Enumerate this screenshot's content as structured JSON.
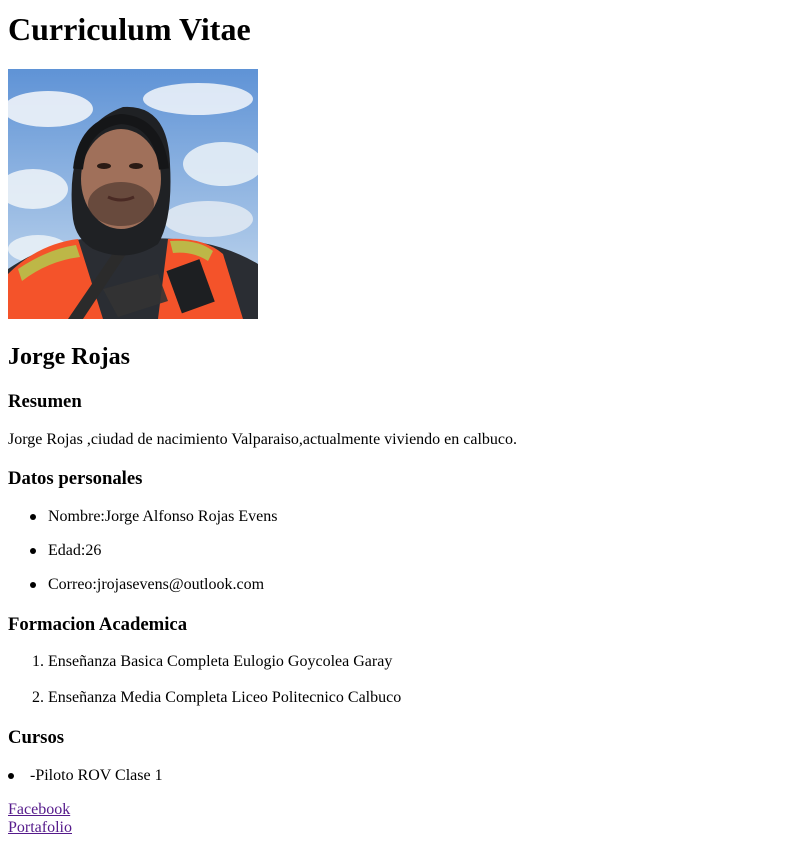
{
  "page": {
    "title": "Curriculum Vitae",
    "name": "Jorge Rojas"
  },
  "resumen": {
    "heading": "Resumen",
    "text": "Jorge Rojas ,ciudad de nacimiento Valparaiso,actualmente viviendo en calbuco."
  },
  "datos": {
    "heading": "Datos personales",
    "items": [
      "Nombre:Jorge Alfonso Rojas Evens",
      "Edad:26",
      "Correo:jrojasevens@outlook.com"
    ]
  },
  "formacion": {
    "heading": "Formacion Academica",
    "markers": [
      "1.",
      "2."
    ],
    "items": [
      "Enseñanza Basica Completa Eulogio Goycolea Garay",
      "Enseñanza Media Completa Liceo Politecnico Calbuco"
    ]
  },
  "cursos": {
    "heading": "Cursos",
    "items": [
      "-Piloto ROV Clase 1"
    ]
  },
  "links": {
    "facebook": "Facebook",
    "portafolio": "Portafolio"
  },
  "colors": {
    "link_visited": "#551a8b",
    "text": "#000000",
    "vest_orange": "#f4532a",
    "sky_blue": "#5b8fd0"
  }
}
